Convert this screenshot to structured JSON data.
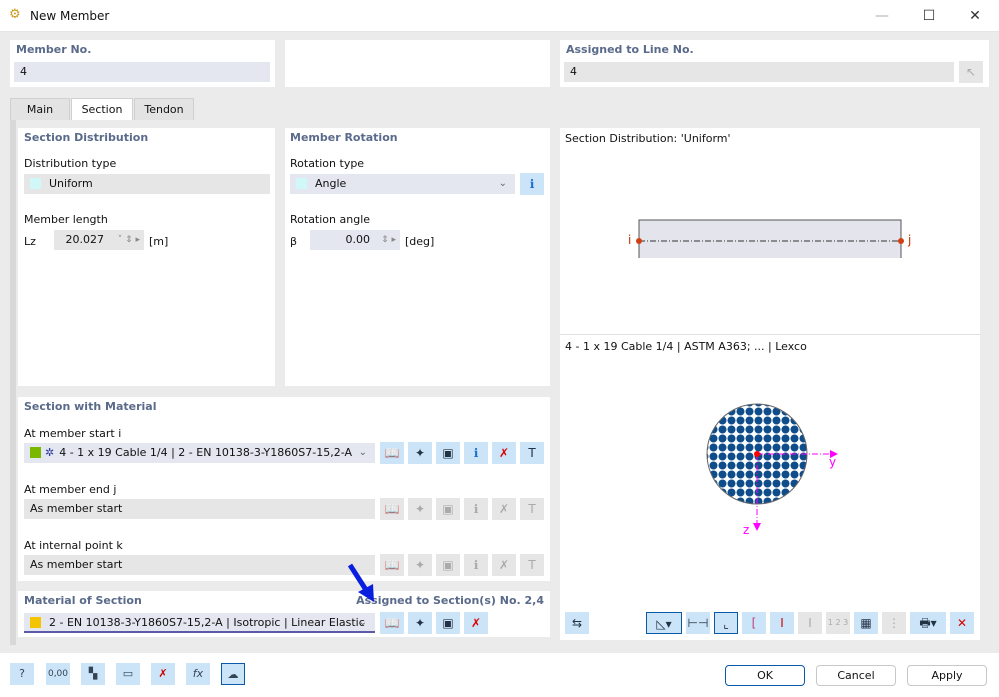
{
  "window": {
    "title": "New Member",
    "minimize": "—",
    "maximize": "☐",
    "close": "✕"
  },
  "member_no": {
    "label": "Member No.",
    "value": "4"
  },
  "assigned_line": {
    "label": "Assigned to Line No.",
    "value": "4"
  },
  "tabs": [
    {
      "label": "Main"
    },
    {
      "label": "Section",
      "active": true
    },
    {
      "label": "Tendon"
    }
  ],
  "section_distribution": {
    "title": "Section Distribution",
    "type_label": "Distribution type",
    "type_value": "Uniform",
    "length_label": "Member length",
    "length_symbol": "Lz",
    "length_value": "20.027",
    "length_unit": "[m]"
  },
  "member_rotation": {
    "title": "Member Rotation",
    "type_label": "Rotation type",
    "type_value": "Angle",
    "angle_label": "Rotation angle",
    "angle_symbol": "β",
    "angle_value": "0.00",
    "angle_unit": "[deg]"
  },
  "section_with_material": {
    "title": "Section with Material",
    "start_label": "At member start i",
    "start_value": "4 - 1 x 19 Cable 1/4 | 2 - EN 10138-3-Y1860S7-15,2-A",
    "end_label": "At member end j",
    "end_value": "As member start",
    "internal_label": "At internal point k",
    "internal_value": "As member start"
  },
  "material_of_section": {
    "title": "Material of Section",
    "assigned": "Assigned to Section(s) No. 2,4",
    "value": "2 - EN 10138-3-Y1860S7-15,2-A | Isotropic | Linear Elastic"
  },
  "preview": {
    "distribution_title": "Section Distribution: 'Uniform'",
    "node_i": "i",
    "node_j": "j",
    "section_title": "4 - 1 x 19 Cable 1/4 | ASTM A363; ... | Lexco",
    "axis_y": "y",
    "axis_z": "z"
  },
  "buttons": {
    "ok": "OK",
    "cancel": "Cancel",
    "apply": "Apply"
  },
  "colors": {
    "section_swatch": "#7ab800",
    "material_swatch": "#f5c400",
    "uniform_swatch": "#d0f8f8",
    "cable_fill": "#0e4c8a",
    "axis": "#ff00ff",
    "accent": "#0a5aa8"
  }
}
